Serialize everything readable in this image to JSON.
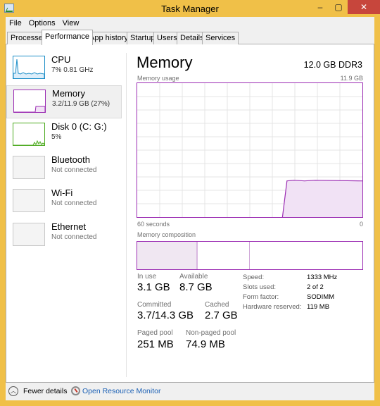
{
  "window": {
    "title": "Task Manager",
    "controls": [
      "–",
      "▢",
      "✕"
    ]
  },
  "menu": [
    "File",
    "Options",
    "View"
  ],
  "tabs": [
    {
      "label": "Processes",
      "active": false
    },
    {
      "label": "Performance",
      "active": true
    },
    {
      "label": "App history",
      "active": false
    },
    {
      "label": "Startup",
      "active": false
    },
    {
      "label": "Users",
      "active": false
    },
    {
      "label": "Details",
      "active": false
    },
    {
      "label": "Services",
      "active": false
    }
  ],
  "sidebar": {
    "items": [
      {
        "name": "CPU",
        "sub": "7%  0.81 GHz",
        "color": "#1e8fc8"
      },
      {
        "name": "Memory",
        "sub": "3.2/11.9 GB (27%)",
        "color": "#9b2cb3",
        "selected": true
      },
      {
        "name": "Disk 0 (C: G:)",
        "sub": "5%",
        "color": "#4caa1f"
      },
      {
        "name": "Bluetooth",
        "sub": "Not connected"
      },
      {
        "name": "Wi-Fi",
        "sub": "Not connected"
      },
      {
        "name": "Ethernet",
        "sub": "Not connected"
      }
    ]
  },
  "main": {
    "title": "Memory",
    "spec": "12.0 GB DDR3",
    "usage_label": "Memory usage",
    "usage_max": "11.9 GB",
    "time_left": "60 seconds",
    "time_right": "0",
    "composition_label": "Memory composition",
    "usage_series": {
      "in_use_fraction": 0.27,
      "accent": "#9b2cb3"
    },
    "stats": {
      "in_use_label": "In use",
      "in_use": "3.1 GB",
      "available_label": "Available",
      "available": "8.7 GB",
      "committed_label": "Committed",
      "committed": "3.7/14.3 GB",
      "cached_label": "Cached",
      "cached": "2.7 GB",
      "paged_label": "Paged pool",
      "paged": "251 MB",
      "nonpaged_label": "Non-paged pool",
      "nonpaged": "74.9 MB"
    },
    "specs": {
      "speed_label": "Speed:",
      "speed": "1333 MHz",
      "slots_label": "Slots used:",
      "slots": "2 of 2",
      "form_label": "Form factor:",
      "form": "SODIMM",
      "reserved_label": "Hardware reserved:",
      "reserved": "119 MB"
    }
  },
  "footer": {
    "fewer_details": "Fewer details",
    "open_monitor": "Open Resource Monitor"
  }
}
